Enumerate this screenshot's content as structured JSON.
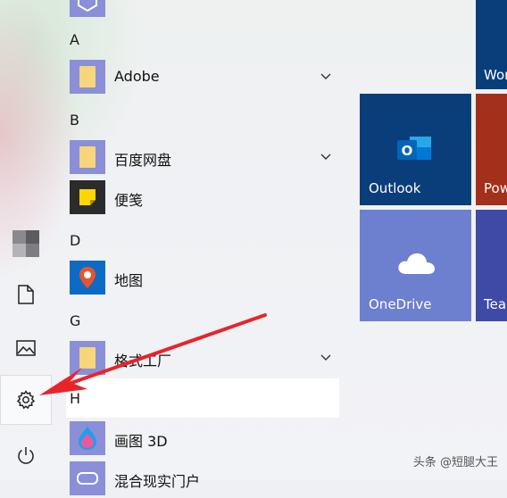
{
  "start_menu": {
    "apps": [
      {
        "letter": "A"
      },
      {
        "name": "Adobe",
        "type": "folder",
        "expandable": true
      },
      {
        "letter": "B"
      },
      {
        "name": "百度网盘",
        "type": "folder",
        "expandable": true
      },
      {
        "name": "便笺",
        "type": "sticky-notes"
      },
      {
        "letter": "D"
      },
      {
        "name": "地图",
        "type": "maps"
      },
      {
        "letter": "G"
      },
      {
        "name": "格式工厂",
        "type": "folder",
        "expandable": true
      },
      {
        "letter": "H"
      },
      {
        "name": "画图 3D",
        "type": "paint3d"
      },
      {
        "name": "混合现实门户",
        "type": "mixed-reality"
      }
    ]
  },
  "tiles": {
    "outlook": {
      "label": "Outlook",
      "color": "#0a3e7a"
    },
    "onedrive": {
      "label": "OneDrive",
      "color": "#6d7fcf"
    },
    "word_partial": {
      "label": "Wor",
      "color": "#0a3e7a"
    },
    "powerpoint_partial": {
      "label": "Pow",
      "color": "#a3301a"
    },
    "teams_partial": {
      "label": "Tear",
      "color": "#3f4aa6"
    }
  },
  "rail": {
    "icons": [
      "avatar",
      "document-icon",
      "pictures-icon",
      "settings-icon",
      "power-icon"
    ]
  },
  "watermark": "头条 @短腿大王",
  "annotation": {
    "color": "#e8242a"
  }
}
